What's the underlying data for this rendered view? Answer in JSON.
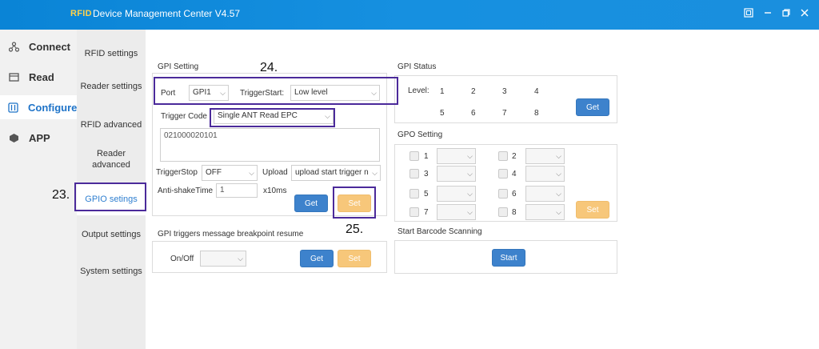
{
  "titlebar": {
    "logo": "RFID",
    "title": "Device Management Center V4.57"
  },
  "nav": [
    {
      "label": "Connect",
      "icon": "connect-icon"
    },
    {
      "label": "Read",
      "icon": "read-icon"
    },
    {
      "label": "Configure",
      "icon": "configure-icon",
      "active": true
    },
    {
      "label": "APP",
      "icon": "app-icon"
    }
  ],
  "subnav": {
    "rfid_settings": "RFID settings",
    "reader_settings": "Reader settings",
    "rfid_advanced": "RFID advanced",
    "reader_advanced_1": "Reader",
    "reader_advanced_2": "advanced",
    "gpio_settings": "GPIO setings",
    "output_settings": "Output settings",
    "system_settings": "System settings"
  },
  "gpi_setting": {
    "title": "GPI Setting",
    "port_label": "Port",
    "port_value": "GPI1",
    "trigger_start_label": "TriggerStart:",
    "trigger_start_value": "Low level",
    "trigger_code_label": "Trigger Code",
    "trigger_code_value": "Single ANT Read EPC",
    "code_text": "021000020101",
    "trigger_stop_label": "TriggerStop",
    "trigger_stop_value": "OFF",
    "upload_label": "Upload",
    "upload_value": "upload start trigger n",
    "antishake_label": "Anti-shakeTime",
    "antishake_value": "1",
    "antishake_unit": "x10ms",
    "get_label": "Get",
    "set_label": "Set"
  },
  "breakpoint": {
    "title": "GPI triggers message breakpoint resume",
    "onoff_label": "On/Off",
    "get_label": "Get",
    "set_label": "Set"
  },
  "gpi_status": {
    "title": "GPI Status",
    "level_label": "Level:",
    "levels": [
      "1",
      "2",
      "3",
      "4",
      "5",
      "6",
      "7",
      "8"
    ],
    "get_label": "Get"
  },
  "gpo_setting": {
    "title": "GPO Setting",
    "items": [
      "1",
      "2",
      "3",
      "4",
      "5",
      "6",
      "7",
      "8"
    ],
    "set_label": "Set"
  },
  "barcode": {
    "title": "Start Barcode Scanning",
    "start_label": "Start"
  },
  "annotations": {
    "a23": "23.",
    "a24": "24.",
    "a25": "25."
  },
  "colors": {
    "titlebar": "#0a84d6",
    "accent": "#3d82cc",
    "set_button": "#f7c77a",
    "annotation": "#4b2a9a"
  }
}
